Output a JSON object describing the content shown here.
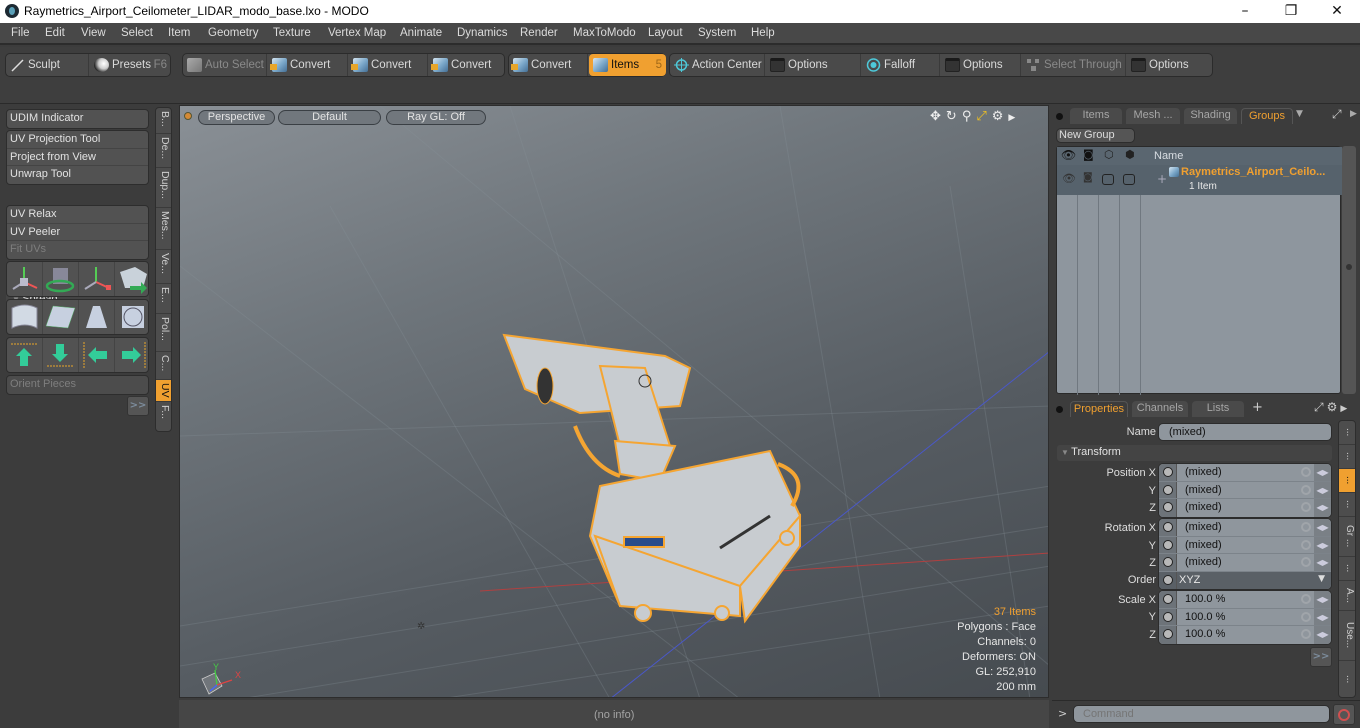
{
  "window": {
    "title": "Raymetrics_Airport_Ceilometer_LIDAR_modo_base.lxo - MODO",
    "controls": {
      "minimize": "–",
      "maximize": "❐",
      "close": "✕"
    }
  },
  "menubar": [
    "File",
    "Edit",
    "View",
    "Select",
    "Item",
    "Geometry",
    "Texture",
    "Vertex Map",
    "Animate",
    "Dynamics",
    "Render",
    "MaxToModo",
    "Layout",
    "System",
    "Help"
  ],
  "toolbar": {
    "sculpt": "Sculpt",
    "presets": "Presets",
    "presets_key": "F6",
    "auto_select": "Auto Select",
    "convert1": "Convert",
    "convert2": "Convert",
    "convert3": "Convert",
    "convert4": "Convert",
    "items": "Items",
    "items_count": "5",
    "action_center": "Action Center",
    "options1": "Options",
    "falloff": "Falloff",
    "options2": "Options",
    "select_through": "Select Through",
    "options3": "Options",
    "accent_color": "#f0a030"
  },
  "left_panel": {
    "udim": "UDIM Indicator",
    "tools": [
      "UV Projection Tool",
      "Project from View",
      "Unwrap Tool"
    ],
    "spread": "Spread",
    "relax_tools": [
      "UV Relax",
      "UV Peeler",
      "Fit UVs"
    ],
    "icon_rows": [
      [
        "move-uv-icon",
        "rotate-uv-icon",
        "scale-uv-icon",
        "mirror-uv-icon"
      ],
      [
        "wrap-uv-icon",
        "plane-uv-icon",
        "trapezoid-uv-icon",
        "sphere-uv-icon"
      ],
      [
        "align-top-icon",
        "align-bottom-icon",
        "align-left-icon",
        "align-right-icon"
      ]
    ],
    "orient": "Orient Pieces",
    "more": ">>",
    "vtabs": [
      "B...",
      "De...",
      "Dup...",
      "Mes...",
      "Ve...",
      "E...",
      "Pol...",
      "C...",
      "UV",
      "F..."
    ],
    "active_vtab": "UV"
  },
  "viewport": {
    "view_mode": "Perspective",
    "shading": "Default",
    "raygl": "Ray GL: Off",
    "nav_icons": [
      "move-view-icon",
      "rotate-view-icon",
      "zoom-view-icon",
      "maximize-view-icon",
      "settings-icon",
      "expand-arrow-icon"
    ],
    "info": {
      "items": "37 Items",
      "polygons": "Polygons : Face",
      "channels": "Channels: 0",
      "deformers": "Deformers: ON",
      "gl": "GL: 252,910",
      "scale": "200 mm"
    },
    "axis": {
      "x": "X",
      "y": "Y"
    }
  },
  "status_bar": {
    "info": "(no info)"
  },
  "groups_panel": {
    "tabs": [
      "Items",
      "Mesh ...",
      "Shading",
      "Groups"
    ],
    "active_tab": "Groups",
    "new_group": "New Group",
    "column_name": "Name",
    "rows": [
      {
        "name": "Raymetrics_Airport_Ceilo...",
        "sub": "1 Item"
      }
    ]
  },
  "properties_panel": {
    "tabs": [
      "Properties",
      "Channels",
      "Lists"
    ],
    "add_tab": "+",
    "active_tab": "Properties",
    "name_label": "Name",
    "name_value": "(mixed)",
    "transform": "Transform",
    "position": {
      "label": "Position X",
      "rows": [
        {
          "axis": "X",
          "value": "(mixed)"
        },
        {
          "axis": "Y",
          "value": "(mixed)"
        },
        {
          "axis": "Z",
          "value": "(mixed)"
        }
      ]
    },
    "rotation": {
      "label": "Rotation X",
      "rows": [
        {
          "axis": "X",
          "value": "(mixed)"
        },
        {
          "axis": "Y",
          "value": "(mixed)"
        },
        {
          "axis": "Z",
          "value": "(mixed)"
        }
      ]
    },
    "order_label": "Order",
    "order_value": "XYZ",
    "scale": {
      "label": "Scale X",
      "rows": [
        {
          "axis": "X",
          "value": "100.0 %"
        },
        {
          "axis": "Y",
          "value": "100.0 %"
        },
        {
          "axis": "Z",
          "value": "100.0 %"
        }
      ]
    },
    "more": ">>",
    "vtabs": [
      "...",
      "...",
      "...",
      "...",
      "Gr ...",
      "...",
      "A...",
      "Use...",
      "..."
    ],
    "active_vtab_index": 2
  },
  "command": {
    "prompt": ">",
    "placeholder": "Command"
  }
}
